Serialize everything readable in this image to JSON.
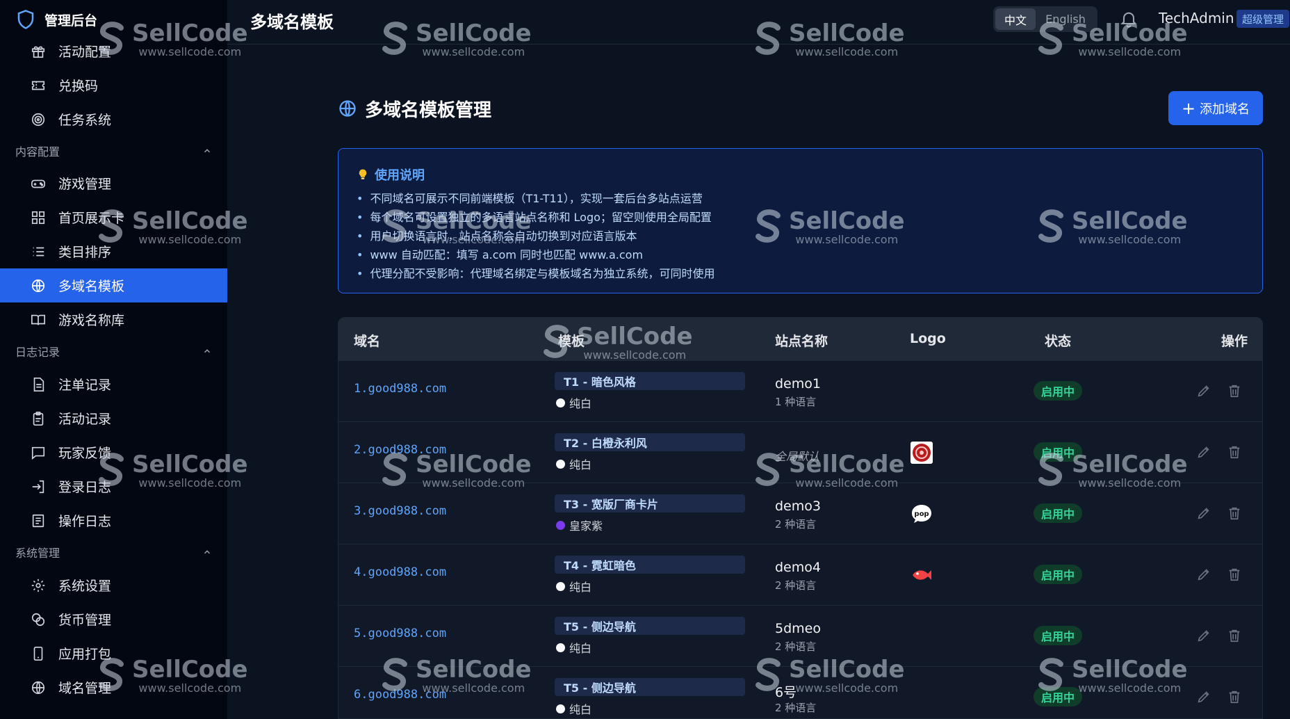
{
  "app": {
    "title": "管理后台"
  },
  "sidebar": {
    "items_top": [
      {
        "label": "活动配置",
        "icon": "gift-icon"
      },
      {
        "label": "兑换码",
        "icon": "ticket-icon"
      },
      {
        "label": "任务系统",
        "icon": "target-icon"
      }
    ],
    "groups": [
      {
        "label": "内容配置",
        "items": [
          {
            "label": "游戏管理",
            "icon": "gamepad-icon"
          },
          {
            "label": "首页展示卡",
            "icon": "grid-icon"
          },
          {
            "label": "类目排序",
            "icon": "list-icon"
          },
          {
            "label": "多域名模板",
            "icon": "globe-icon",
            "active": true
          },
          {
            "label": "游戏名称库",
            "icon": "book-icon"
          }
        ]
      },
      {
        "label": "日志记录",
        "items": [
          {
            "label": "注单记录",
            "icon": "file-text-icon"
          },
          {
            "label": "活动记录",
            "icon": "clipboard-icon"
          },
          {
            "label": "玩家反馈",
            "icon": "message-icon"
          },
          {
            "label": "登录日志",
            "icon": "login-icon"
          },
          {
            "label": "操作日志",
            "icon": "log-icon"
          }
        ]
      },
      {
        "label": "系统管理",
        "items": [
          {
            "label": "系统设置",
            "icon": "gear-icon"
          },
          {
            "label": "货币管理",
            "icon": "coins-icon"
          },
          {
            "label": "应用打包",
            "icon": "phone-icon"
          },
          {
            "label": "域名管理",
            "icon": "globe-icon"
          }
        ]
      }
    ]
  },
  "header": {
    "page_title": "多域名模板",
    "lang_zh": "中文",
    "lang_en": "English",
    "username": "TechAdmin",
    "role": "超级管理"
  },
  "main": {
    "title": "多域名模板管理",
    "add_button": "添加域名",
    "notice": {
      "title": "使用说明",
      "lines": [
        "不同域名可展示不同前端模板（T1-T11），实现一套后台多站点运营",
        "每个域名可设置独立的多语言站点名称和 Logo；留空则使用全局配置",
        "用户切换语言时，站点名称会自动切换到对应语言版本",
        "www 自动匹配：填写 a.com 同时也匹配 www.a.com",
        "代理分配不受影响：代理域名绑定与模板域名为独立系统，可同时使用"
      ]
    },
    "table": {
      "headers": [
        "域名",
        "模板",
        "站点名称",
        "Logo",
        "状态",
        "操作"
      ],
      "rows": [
        {
          "domain": "1.good988.com",
          "template": "T1 - 暗色风格",
          "theme": "纯白",
          "theme_color": "#f9fafb",
          "site": "demo1",
          "site_italic": false,
          "langs": "1 种语言",
          "logo": "",
          "status": "启用中"
        },
        {
          "domain": "2.good988.com",
          "template": "T2 - 白橙永利风",
          "theme": "纯白",
          "theme_color": "#f9fafb",
          "site": "全局默认",
          "site_italic": true,
          "langs": "",
          "logo": "badge-logo-icon",
          "status": "启用中"
        },
        {
          "domain": "3.good988.com",
          "template": "T3 - 宽版厂商卡片",
          "theme": "皇家紫",
          "theme_color": "#7c3aed",
          "site": "demo3",
          "site_italic": false,
          "langs": "2 种语言",
          "logo": "pop-logo-icon",
          "status": "启用中"
        },
        {
          "domain": "4.good988.com",
          "template": "T4 - 霓虹暗色",
          "theme": "纯白",
          "theme_color": "#f9fafb",
          "site": "demo4",
          "site_italic": false,
          "langs": "2 种语言",
          "logo": "fish-logo-icon",
          "status": "启用中"
        },
        {
          "domain": "5.good988.com",
          "template": "T5 - 侧边导航",
          "theme": "纯白",
          "theme_color": "#f9fafb",
          "site": "5dmeo",
          "site_italic": false,
          "langs": "2 种语言",
          "logo": "",
          "status": "启用中"
        },
        {
          "domain": "6.good988.com",
          "template": "T5 - 侧边导航",
          "theme": "纯白",
          "theme_color": "#f9fafb",
          "site": "6号",
          "site_italic": false,
          "langs": "2 种语言",
          "logo": "",
          "status": "启用中"
        }
      ]
    }
  },
  "watermark": {
    "brand": "SellCode",
    "url": "www.sellcode.com"
  },
  "colors": {
    "accent": "#2563eb",
    "status_green": "#34d399",
    "link": "#60a5fa"
  }
}
